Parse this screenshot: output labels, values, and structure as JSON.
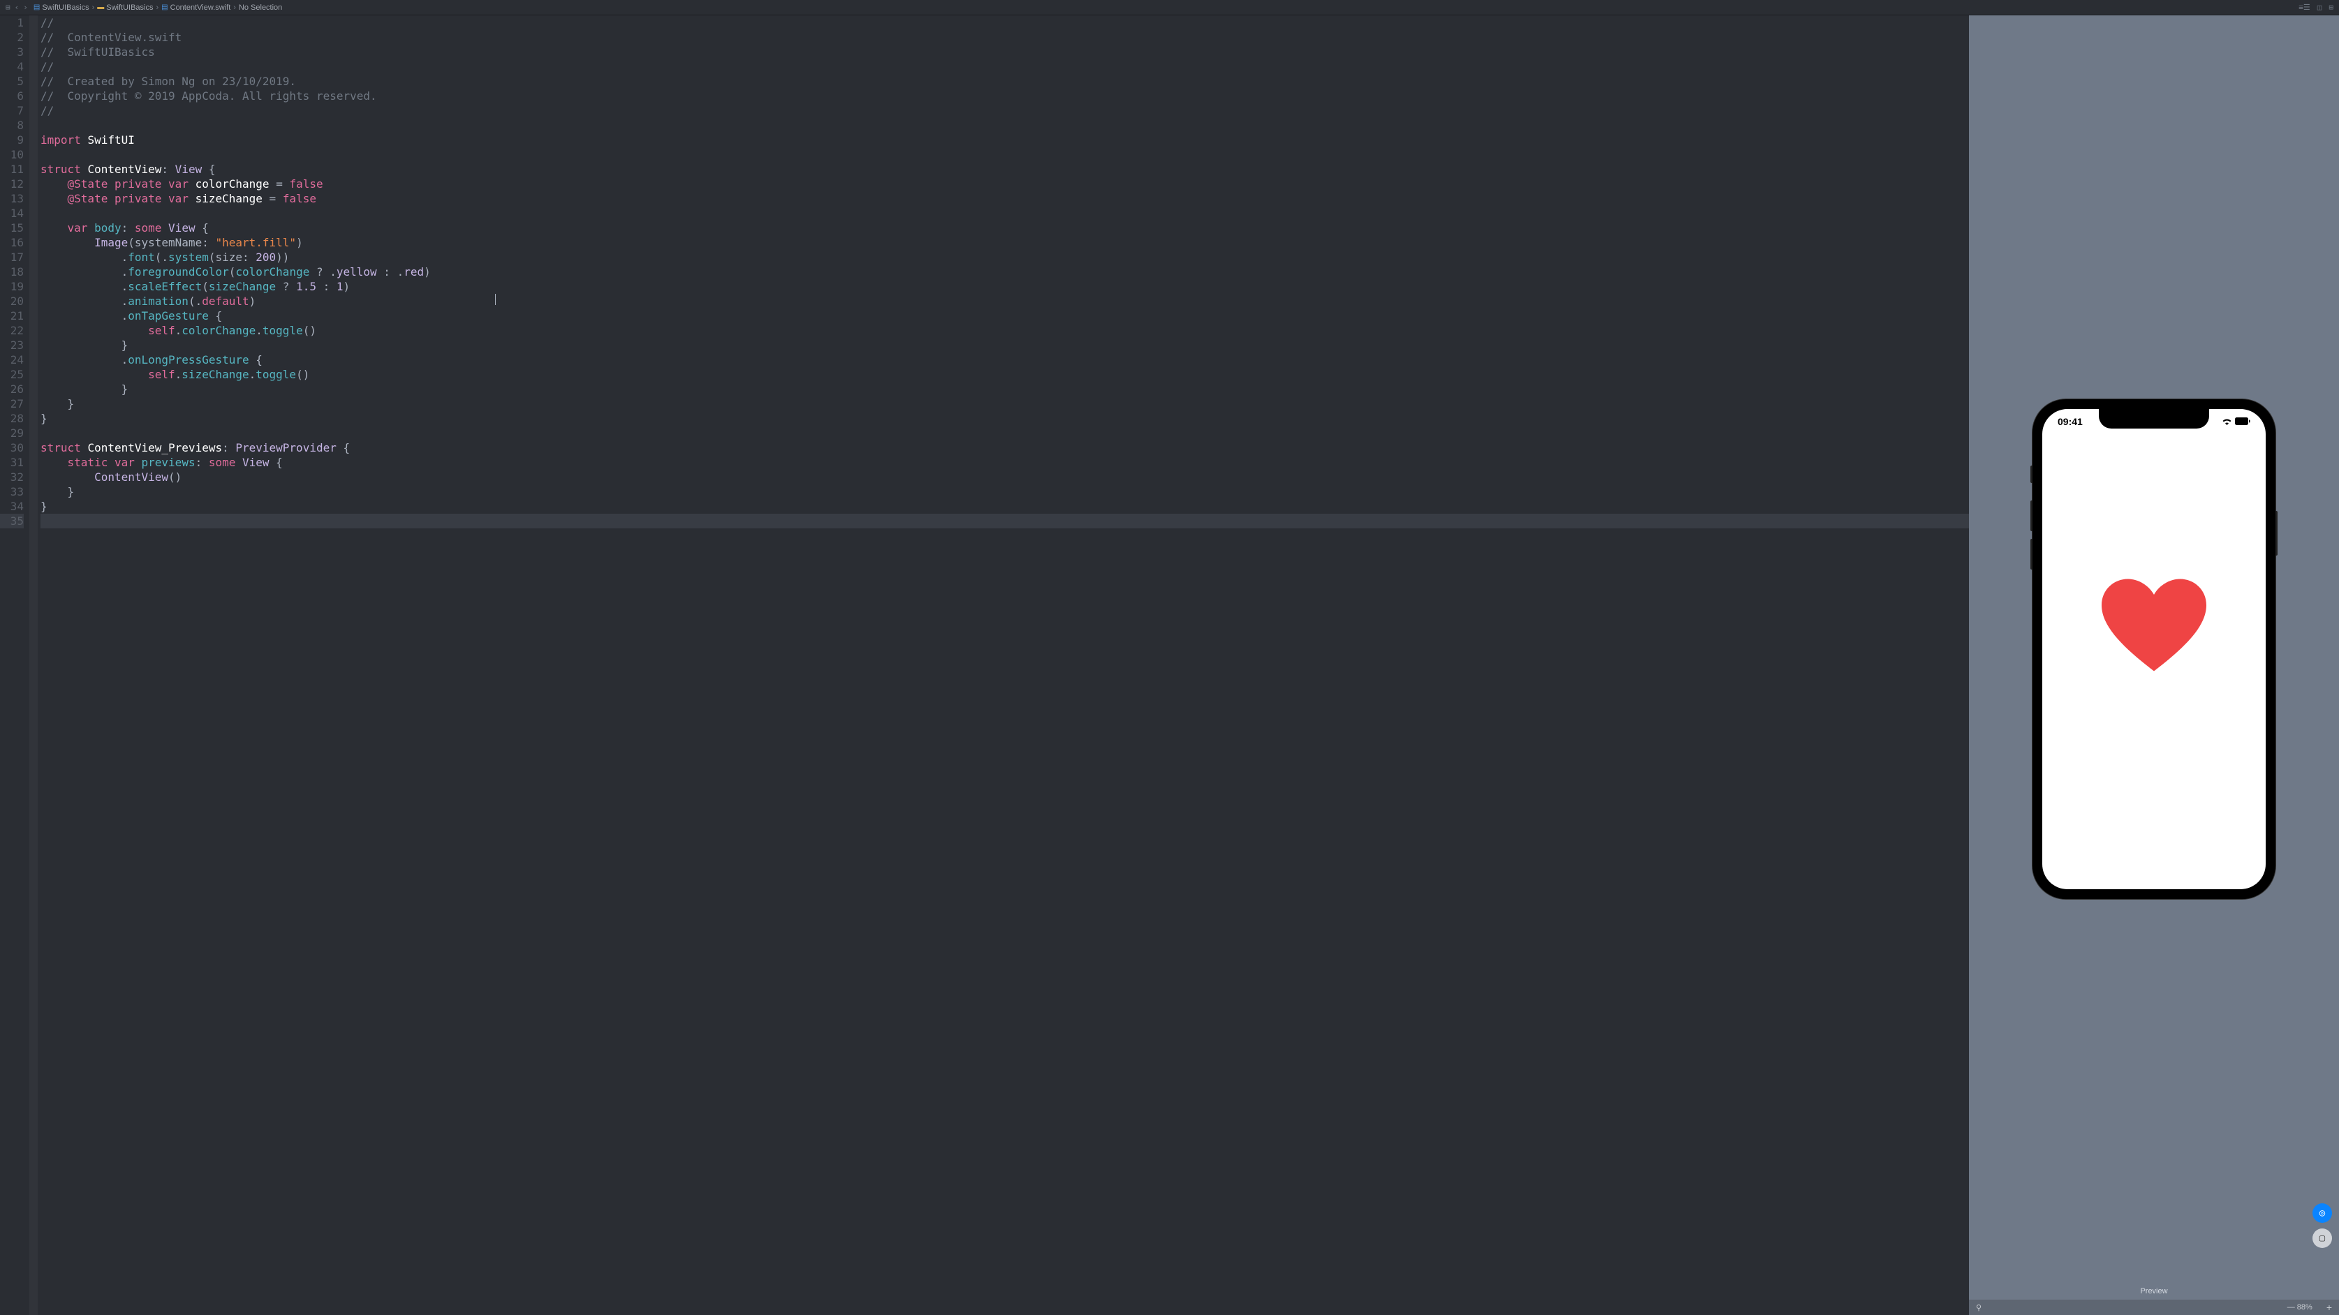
{
  "breadcrumb": {
    "items": [
      {
        "icon": "swift",
        "label": "SwiftUIBasics"
      },
      {
        "icon": "folder",
        "label": "SwiftUIBasics"
      },
      {
        "icon": "swift",
        "label": "ContentView.swift"
      },
      {
        "icon": "",
        "label": "No Selection"
      }
    ]
  },
  "code": {
    "lines": [
      [
        {
          "t": "//",
          "c": "c-comment"
        }
      ],
      [
        {
          "t": "//  ContentView.swift",
          "c": "c-comment"
        }
      ],
      [
        {
          "t": "//  SwiftUIBasics",
          "c": "c-comment"
        }
      ],
      [
        {
          "t": "//",
          "c": "c-comment"
        }
      ],
      [
        {
          "t": "//  Created by Simon Ng on 23/10/2019.",
          "c": "c-comment"
        }
      ],
      [
        {
          "t": "//  Copyright © 2019 AppCoda. All rights reserved.",
          "c": "c-comment"
        }
      ],
      [
        {
          "t": "//",
          "c": "c-comment"
        }
      ],
      [],
      [
        {
          "t": "import",
          "c": "c-keyword"
        },
        {
          "t": " ",
          "c": "c-default"
        },
        {
          "t": "SwiftUI",
          "c": "c-ident"
        }
      ],
      [],
      [
        {
          "t": "struct",
          "c": "c-keyword"
        },
        {
          "t": " ",
          "c": "c-default"
        },
        {
          "t": "ContentView",
          "c": "c-ident"
        },
        {
          "t": ": ",
          "c": "c-default"
        },
        {
          "t": "View",
          "c": "c-type"
        },
        {
          "t": " {",
          "c": "c-default"
        }
      ],
      [
        {
          "t": "    ",
          "c": "c-default"
        },
        {
          "t": "@State",
          "c": "c-keyword"
        },
        {
          "t": " ",
          "c": "c-default"
        },
        {
          "t": "private",
          "c": "c-keyword"
        },
        {
          "t": " ",
          "c": "c-default"
        },
        {
          "t": "var",
          "c": "c-keyword"
        },
        {
          "t": " ",
          "c": "c-default"
        },
        {
          "t": "colorChange",
          "c": "c-ident"
        },
        {
          "t": " = ",
          "c": "c-default"
        },
        {
          "t": "false",
          "c": "c-keyword"
        }
      ],
      [
        {
          "t": "    ",
          "c": "c-default"
        },
        {
          "t": "@State",
          "c": "c-keyword"
        },
        {
          "t": " ",
          "c": "c-default"
        },
        {
          "t": "private",
          "c": "c-keyword"
        },
        {
          "t": " ",
          "c": "c-default"
        },
        {
          "t": "var",
          "c": "c-keyword"
        },
        {
          "t": " ",
          "c": "c-default"
        },
        {
          "t": "sizeChange",
          "c": "c-ident"
        },
        {
          "t": " = ",
          "c": "c-default"
        },
        {
          "t": "false",
          "c": "c-keyword"
        }
      ],
      [],
      [
        {
          "t": "    ",
          "c": "c-default"
        },
        {
          "t": "var",
          "c": "c-keyword"
        },
        {
          "t": " ",
          "c": "c-default"
        },
        {
          "t": "body",
          "c": "c-prop"
        },
        {
          "t": ": ",
          "c": "c-default"
        },
        {
          "t": "some",
          "c": "c-keyword"
        },
        {
          "t": " ",
          "c": "c-default"
        },
        {
          "t": "View",
          "c": "c-type"
        },
        {
          "t": " {",
          "c": "c-default"
        }
      ],
      [
        {
          "t": "        ",
          "c": "c-default"
        },
        {
          "t": "Image",
          "c": "c-type"
        },
        {
          "t": "(systemName: ",
          "c": "c-default"
        },
        {
          "t": "\"heart.fill\"",
          "c": "c-string"
        },
        {
          "t": ")",
          "c": "c-default"
        }
      ],
      [
        {
          "t": "            .",
          "c": "c-default"
        },
        {
          "t": "font",
          "c": "c-func"
        },
        {
          "t": "(.",
          "c": "c-default"
        },
        {
          "t": "system",
          "c": "c-func"
        },
        {
          "t": "(size: ",
          "c": "c-default"
        },
        {
          "t": "200",
          "c": "c-num"
        },
        {
          "t": "))",
          "c": "c-default"
        }
      ],
      [
        {
          "t": "            .",
          "c": "c-default"
        },
        {
          "t": "foregroundColor",
          "c": "c-func"
        },
        {
          "t": "(",
          "c": "c-default"
        },
        {
          "t": "colorChange",
          "c": "c-prop"
        },
        {
          "t": " ? .",
          "c": "c-default"
        },
        {
          "t": "yellow",
          "c": "c-enum"
        },
        {
          "t": " : .",
          "c": "c-default"
        },
        {
          "t": "red",
          "c": "c-enum"
        },
        {
          "t": ")",
          "c": "c-default"
        }
      ],
      [
        {
          "t": "            .",
          "c": "c-default"
        },
        {
          "t": "scaleEffect",
          "c": "c-func"
        },
        {
          "t": "(",
          "c": "c-default"
        },
        {
          "t": "sizeChange",
          "c": "c-prop"
        },
        {
          "t": " ? ",
          "c": "c-default"
        },
        {
          "t": "1.5",
          "c": "c-num"
        },
        {
          "t": " : ",
          "c": "c-default"
        },
        {
          "t": "1",
          "c": "c-num"
        },
        {
          "t": ")",
          "c": "c-default"
        }
      ],
      [
        {
          "t": "            .",
          "c": "c-default"
        },
        {
          "t": "animation",
          "c": "c-func"
        },
        {
          "t": "(.",
          "c": "c-default"
        },
        {
          "t": "default",
          "c": "c-keyword"
        },
        {
          "t": ")",
          "c": "c-default"
        }
      ],
      [
        {
          "t": "            .",
          "c": "c-default"
        },
        {
          "t": "onTapGesture",
          "c": "c-func"
        },
        {
          "t": " {",
          "c": "c-default"
        }
      ],
      [
        {
          "t": "                ",
          "c": "c-default"
        },
        {
          "t": "self",
          "c": "c-self"
        },
        {
          "t": ".",
          "c": "c-default"
        },
        {
          "t": "colorChange",
          "c": "c-prop"
        },
        {
          "t": ".",
          "c": "c-default"
        },
        {
          "t": "toggle",
          "c": "c-func"
        },
        {
          "t": "()",
          "c": "c-default"
        }
      ],
      [
        {
          "t": "            }",
          "c": "c-default"
        }
      ],
      [
        {
          "t": "            .",
          "c": "c-default"
        },
        {
          "t": "onLongPressGesture",
          "c": "c-func"
        },
        {
          "t": " {",
          "c": "c-default"
        }
      ],
      [
        {
          "t": "                ",
          "c": "c-default"
        },
        {
          "t": "self",
          "c": "c-self"
        },
        {
          "t": ".",
          "c": "c-default"
        },
        {
          "t": "sizeChange",
          "c": "c-prop"
        },
        {
          "t": ".",
          "c": "c-default"
        },
        {
          "t": "toggle",
          "c": "c-func"
        },
        {
          "t": "()",
          "c": "c-default"
        }
      ],
      [
        {
          "t": "            }",
          "c": "c-default"
        }
      ],
      [
        {
          "t": "    }",
          "c": "c-default"
        }
      ],
      [
        {
          "t": "}",
          "c": "c-default"
        }
      ],
      [],
      [
        {
          "t": "struct",
          "c": "c-keyword"
        },
        {
          "t": " ",
          "c": "c-default"
        },
        {
          "t": "ContentView_Previews",
          "c": "c-ident"
        },
        {
          "t": ": ",
          "c": "c-default"
        },
        {
          "t": "PreviewProvider",
          "c": "c-type"
        },
        {
          "t": " {",
          "c": "c-default"
        }
      ],
      [
        {
          "t": "    ",
          "c": "c-default"
        },
        {
          "t": "static",
          "c": "c-keyword"
        },
        {
          "t": " ",
          "c": "c-default"
        },
        {
          "t": "var",
          "c": "c-keyword"
        },
        {
          "t": " ",
          "c": "c-default"
        },
        {
          "t": "previews",
          "c": "c-prop"
        },
        {
          "t": ": ",
          "c": "c-default"
        },
        {
          "t": "some",
          "c": "c-keyword"
        },
        {
          "t": " ",
          "c": "c-default"
        },
        {
          "t": "View",
          "c": "c-type"
        },
        {
          "t": " {",
          "c": "c-default"
        }
      ],
      [
        {
          "t": "        ",
          "c": "c-default"
        },
        {
          "t": "ContentView",
          "c": "c-type"
        },
        {
          "t": "()",
          "c": "c-default"
        }
      ],
      [
        {
          "t": "    }",
          "c": "c-default"
        }
      ],
      [
        {
          "t": "}",
          "c": "c-default"
        }
      ],
      []
    ]
  },
  "preview": {
    "label": "Preview",
    "time": "09:41",
    "zoom": "88%"
  }
}
